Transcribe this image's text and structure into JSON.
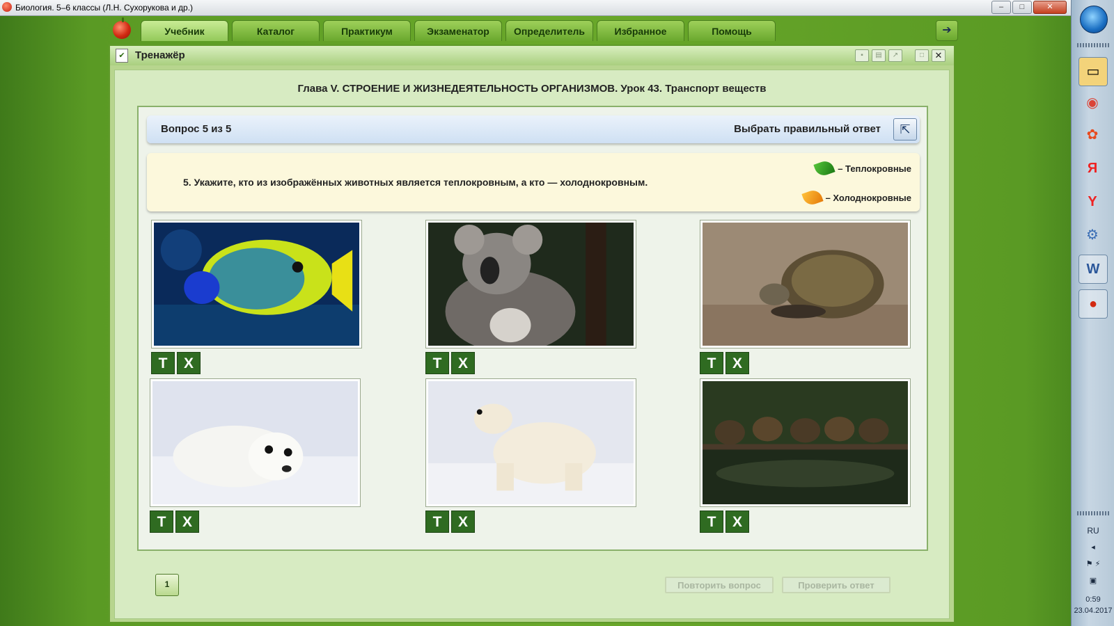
{
  "window": {
    "title": "Биология. 5–6 классы (Л.Н. Сухорукова и др.)",
    "controls": [
      "–",
      "□",
      "✕"
    ]
  },
  "nav": {
    "tabs": [
      "Учебник",
      "Каталог",
      "Практикум",
      "Экзаменатор",
      "Определитель",
      "Избранное",
      "Помощь"
    ],
    "active": "Учебник"
  },
  "trainer": {
    "title": "Тренажёр"
  },
  "chapter": "Глава V. СТРОЕНИЕ И ЖИЗНЕДЕЯТЕЛЬНОСТЬ ОРГАНИЗМОВ. Урок 43. Транспорт веществ",
  "question": {
    "counter": "Вопрос 5 из 5",
    "mode": "Выбрать правильный ответ",
    "text": "5. Укажите, кто из изображённых животных является теплокровным, а кто — холоднокровным.",
    "legend_warm": "– Теплокровные",
    "legend_cold": "– Холоднокровные"
  },
  "answer_buttons": {
    "warm": "Т",
    "cold": "Х"
  },
  "animals": [
    {
      "id": "fish",
      "image": "fish-photo"
    },
    {
      "id": "koala",
      "image": "koala-photo"
    },
    {
      "id": "tortoise",
      "image": "tortoise-photo"
    },
    {
      "id": "seal",
      "image": "seal-photo"
    },
    {
      "id": "polar-bear",
      "image": "polar-bear-photo"
    },
    {
      "id": "ducklings",
      "image": "ducklings-photo"
    }
  ],
  "footer": {
    "counter_icon": "1",
    "repeat": "Повторить вопрос",
    "check": "Проверить ответ"
  },
  "taskbar": {
    "lang": "RU",
    "time": "0:59",
    "date": "23.04.2017"
  },
  "colors": {
    "accent_green": "#6aa82e",
    "answer_button": "#2f6b21",
    "question_bar": "#cfe0f3",
    "question_text_bg": "#fcf8dc"
  }
}
